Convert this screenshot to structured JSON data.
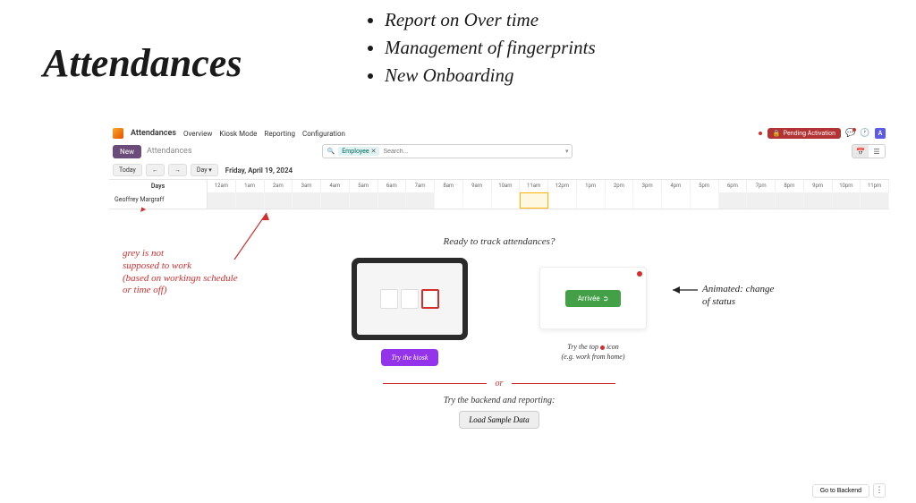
{
  "slide": {
    "title": "Attendances",
    "bullets": [
      "Report on Over time",
      "Management of fingerprints",
      "New Onboarding"
    ]
  },
  "nav": {
    "app_name": "Attendances",
    "links": [
      "Overview",
      "Kiosk Mode",
      "Reporting",
      "Configuration"
    ],
    "pending_label": "Pending Activation",
    "avatar_initial": "A"
  },
  "subbar": {
    "new_label": "New",
    "breadcrumb": "Attendances",
    "search_chip": "Employee",
    "search_placeholder": "Search...",
    "view_options": [
      "calendar",
      "list"
    ]
  },
  "controls": {
    "today": "Today",
    "prev": "←",
    "next": "→",
    "range": "Day",
    "date_label": "Friday, April 19, 2024"
  },
  "timeline": {
    "days_header": "Days",
    "hours": [
      "12am",
      "1am",
      "2am",
      "3am",
      "4am",
      "5am",
      "6am",
      "7am",
      "8am",
      "9am",
      "10am",
      "11am",
      "12pm",
      "1pm",
      "2pm",
      "3pm",
      "4pm",
      "5pm",
      "6pm",
      "7pm",
      "8pm",
      "9pm",
      "10pm",
      "11pm"
    ],
    "row_name": "Geoffrey Margraff",
    "work_start_index": 8,
    "work_end_index": 18,
    "highlight_index": 11
  },
  "onboard": {
    "title": "Ready to track attendances?",
    "try_kiosk": "Try the kiosk",
    "arrivee_label": "Arrivée",
    "status_line1": "Try the top",
    "status_line2_suffix": "icon",
    "status_line3": "(e.g. work from home)",
    "or_text": "or",
    "backend_text": "Try the backend and reporting:",
    "load_btn": "Load Sample Data",
    "go_backend": "Go to Backend"
  },
  "annotations": {
    "employee_name": "Geoffrey Margraff",
    "grey_note": "grey is not\nsupposed to work\n(based on workingn schedule\nor time off)",
    "animated_note": "Animated: change\nof status"
  }
}
